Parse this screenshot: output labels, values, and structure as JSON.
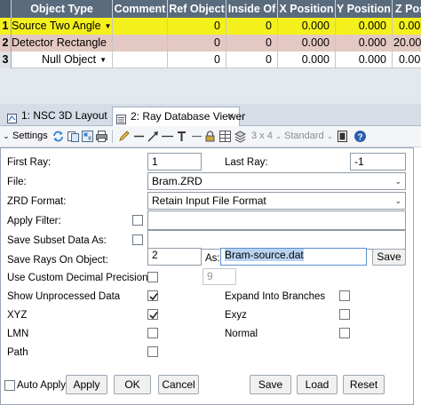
{
  "table": {
    "headers": [
      "Object Type",
      "Comment",
      "Ref Object",
      "Inside Of",
      "X Position",
      "Y Position",
      "Z Pos"
    ],
    "rows": [
      {
        "num": "1",
        "type": "Source Two Angle",
        "comment": "",
        "ref": "0",
        "inside": "0",
        "x": "0.000",
        "y": "0.000",
        "z": "0.00",
        "color": "#f4f01c"
      },
      {
        "num": "2",
        "type": "Detector Rectangle",
        "comment": "",
        "ref": "0",
        "inside": "0",
        "x": "0.000",
        "y": "0.000",
        "z": "20.00",
        "color": "#e4c8c3"
      },
      {
        "num": "3",
        "type": "Null Object",
        "comment": "",
        "ref": "0",
        "inside": "0",
        "x": "0.000",
        "y": "0.000",
        "z": "0.00",
        "color": "#ffffff"
      }
    ]
  },
  "tabs": [
    {
      "label": "1: NSC 3D Layout"
    },
    {
      "label": "2: Ray Database Viewer"
    }
  ],
  "tab_close": "✕",
  "toolbar": {
    "settings_label": "Settings",
    "grid_label": "3 x 4",
    "standard_label": "Standard"
  },
  "form": {
    "first_ray_label": "First Ray:",
    "first_ray_value": "1",
    "last_ray_label": "Last Ray:",
    "last_ray_value": "-1",
    "file_label": "File:",
    "file_value": "Bram.ZRD",
    "zrd_format_label": "ZRD Format:",
    "zrd_format_value": "Retain Input File Format",
    "apply_filter_label": "Apply Filter:",
    "save_subset_label": "Save Subset Data As:",
    "save_rays_label": "Save Rays On Object:",
    "save_rays_value": "2",
    "as_label": "As:",
    "as_value": "Bram-source.dat",
    "save_small_label": "Save",
    "custom_precision_label": "Use Custom Decimal Precision",
    "precision_value": "9",
    "show_unprocessed_label": "Show Unprocessed Data",
    "show_unprocessed_checked": true,
    "expand_branches_label": "Expand Into Branches",
    "xyz_label": "XYZ",
    "xyz_checked": true,
    "exyz_label": "Exyz",
    "lmn_label": "LMN",
    "normal_label": "Normal",
    "path_label": "Path"
  },
  "buttons": {
    "auto_apply": "Auto Apply",
    "apply": "Apply",
    "ok": "OK",
    "cancel": "Cancel",
    "save": "Save",
    "load": "Load",
    "reset": "Reset"
  },
  "colors": {
    "header_bg": "#5a6b7d",
    "row1_bg": "#f4f01c",
    "row2_bg": "#e4c8c3",
    "highlight": "#b9d3f0"
  }
}
